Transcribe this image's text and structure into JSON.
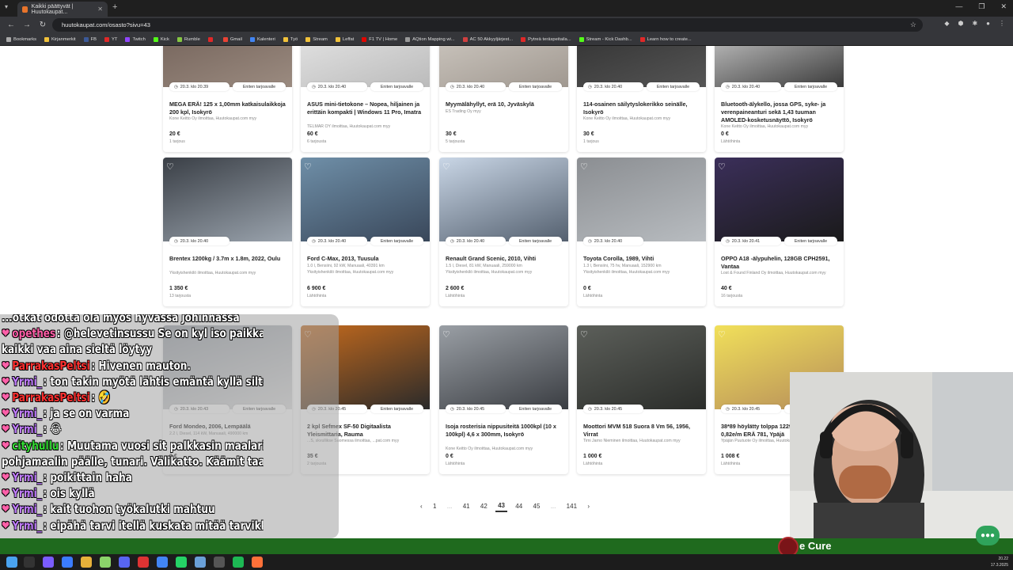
{
  "browser": {
    "tab_title": "Kaikki päättyvät | Huutokaupat...",
    "url": "huutokaupat.com/osasto?sivu=43",
    "bookmarks": [
      {
        "label": "Bookmarks",
        "color": "#aaaaaa"
      },
      {
        "label": "Kirjanmerkit",
        "color": "#f2c23a"
      },
      {
        "label": "FB",
        "color": "#3b5998"
      },
      {
        "label": "YT",
        "color": "#e02828"
      },
      {
        "label": "Twitch",
        "color": "#9146ff"
      },
      {
        "label": "Kick",
        "color": "#53fc18"
      },
      {
        "label": "Rumble",
        "color": "#85c742"
      },
      {
        "label": "",
        "color": "#e02828"
      },
      {
        "label": "Gmail",
        "color": "#ea4335"
      },
      {
        "label": "Kalenteri",
        "color": "#4285f4"
      },
      {
        "label": "Työ",
        "color": "#f2c23a"
      },
      {
        "label": "Stream",
        "color": "#f2c23a"
      },
      {
        "label": "Leffat",
        "color": "#f2c23a"
      },
      {
        "label": "F1 TV | Home",
        "color": "#e10600"
      },
      {
        "label": "AQtion Mapping wi...",
        "color": "#999999"
      },
      {
        "label": "AC 50 Akkyyljärjest...",
        "color": "#d04040"
      },
      {
        "label": "Pytreä teräspeitaila...",
        "color": "#e02828"
      },
      {
        "label": "Stream - Kick Dashb...",
        "color": "#53fc18"
      },
      {
        "label": "Learn how to create...",
        "color": "#e02828"
      }
    ]
  },
  "listings": [
    {
      "time": "20.3. klo 20.39",
      "offer": "Eniten tarjoavalle",
      "title": "MEGA ERÄ! 125 x 1,00mm katkaisulaikkoja 200 kpl, Isokyrö",
      "seller": "Kone Keitto Oy ilmoittaa, Huutokaupat.com myy",
      "price": "20 €",
      "bids": "1 tarjous"
    },
    {
      "time": "20.3. klo 20.40",
      "offer": "Eniten tarjoavalle",
      "title": "ASUS mini-tietokone – Nopea, hiljainen ja erittäin kompakti | Windows 11 Pro, Imatra",
      "seller": "TELMAR OY ilmoittaa, Huutokaupat.com myy",
      "price": "60 €",
      "bids": "6 tarjousta"
    },
    {
      "time": "20.3. klo 20.40",
      "offer": "Eniten tarjoavalle",
      "title": "Myymälähyllyt, erä 10, Jyväskylä",
      "seller": "ES Trading Oy myy",
      "price": "30 €",
      "bids": "5 tarjousta"
    },
    {
      "time": "20.3. klo 20.40",
      "offer": "Eniten tarjoavalle",
      "title": "114-osainen säilytyslokerikko seinälle, Isokyrö",
      "seller": "Kone Keitto Oy ilmoittaa, Huutokaupat.com myy",
      "price": "30 €",
      "bids": "1 tarjous"
    },
    {
      "time": "20.3. klo 20.40",
      "offer": "Eniten tarjoavalle",
      "title": "Bluetooth-älykello, jossa GPS, syke- ja verenpaineanturi sekä 1,43 tuuman AMOLED-kosketusnäyttö, Isokyrö",
      "seller": "Kone Keitto Oy ilmoittaa, Huutokaupat.com myy",
      "price": "0 €",
      "bids": "Lähtöhinta"
    },
    {
      "time": "20.3. klo 20.40",
      "offer": "",
      "title": "Brentex 1200kg / 3.7m x 1.8m, 2022, Oulu",
      "seller": "Yksityishenkilö ilmoittaa, Huutokaupat.com myy",
      "price": "1 350 €",
      "bids": "13 tarjousta"
    },
    {
      "time": "20.3. klo 20.40",
      "offer": "Eniten tarjoavalle",
      "title": "Ford C-Max, 2013, Tuusula",
      "seller": "1.0 l, Bensiini, 92 kW, Manuaali, 40391 km\nYksityishenkilö ilmoittaa, Huutokaupat.com myy",
      "price": "6 900 €",
      "bids": "Lähtöhinta"
    },
    {
      "time": "20.3. klo 20.40",
      "offer": "Eniten tarjoavalle",
      "title": "Renault Grand Scenic, 2010, Vihti",
      "seller": "1.5 l, Diesel, 81 kW, Manuaali, 259000 km\nYksityishenkilö ilmoittaa, Huutokaupat.com myy",
      "price": "2 600 €",
      "bids": "Lähtöhinta"
    },
    {
      "time": "20.3. klo 20.40",
      "offer": "",
      "title": "Toyota Corolla, 1989, Vihti",
      "seller": "1.3 l, Bensiini, 75 hv, Manuaali, 152900 km\nYksityishenkilö ilmoittaa, Huutokaupat.com myy",
      "price": "0 €",
      "bids": "Lähtöhinta"
    },
    {
      "time": "20.3. klo 20.41",
      "offer": "Eniten tarjoavalle",
      "title": "OPPO A18 -älypuhelin, 128GB CPH2591, Vantaa",
      "seller": "Lost & Found Finland Oy ilmoittaa, Huutokaupat.com myy",
      "price": "40 €",
      "bids": "16 tarjousta"
    },
    {
      "time": "20.3. klo 20.43",
      "offer": "Eniten tarjoavalle",
      "title": "Ford Mondeo, 2006, Lempäälä",
      "seller": "2.2 l, Diesel, 114 kW, Manuaali, 490000 km",
      "price": "0 €",
      "bids": "Lähtöhinta"
    },
    {
      "time": "20.3. klo 20.45",
      "offer": "Eniten tarjoavalle",
      "title": "2 kpl Sefmex SF-50 Digitaalista Yleismittaria, Rauma",
      "seller": "...S, skvullikse Suomessa ilmoittaa, ...pat.com myy",
      "price": "35 €",
      "bids": "2 tarjousta"
    },
    {
      "time": "20.3. klo 20.45",
      "offer": "Eniten tarjoavalle",
      "title": "Isoja rosterisia nippusiteitä 1000kpl (10 x 100kpl) 4,6 x 300mm, Isokyrö",
      "seller": "Kone Keitto Oy ilmoittaa, Huutokaupat.com myy",
      "price": "0 €",
      "bids": "Lähtöhinta"
    },
    {
      "time": "20.3. klo 20.45",
      "offer": "",
      "title": "Moottori MVM 518 Suora 8 Vm 56, 1956, Virrat",
      "seller": "Timi Jarno Nieminen ilmoittaa, Huutokaupat.com myy",
      "price": "1 000 €",
      "bids": "Lähtöhinta"
    },
    {
      "time": "20.3. klo 20.45",
      "offer": "Eniten tarjoavalle",
      "title": "38*89 höylätty tolppa 1229m n.1,8€/m 0,82e/m ERÄ 781, Ypäjä",
      "seller": "Ypäjän Puutuote Oy ilmoittaa, Huutokaupat.com myy",
      "price": "1 008 €",
      "bids": "Lähtöhinta"
    }
  ],
  "pagination": [
    "1",
    "...",
    "41",
    "42",
    "43",
    "44",
    "45",
    "...",
    "141"
  ],
  "pagination_current": "43",
  "chat": [
    {
      "user": "",
      "text": "...otkat odotta ola myos hyvassa johinnassa",
      "color": "#ffffff"
    },
    {
      "user": "opethes",
      "text": ": @helevetinsussu Se on kyl iso paikka se jemma ku",
      "color": "#ff5fa8"
    },
    {
      "user": "",
      "text": "kaikki vaa aina sieltä löytyy",
      "color": "#ffffff"
    },
    {
      "user": "ParrakasPeltsi",
      "text": ": Hivenen mauton.",
      "color": "#ff3030"
    },
    {
      "user": "Yrmi_",
      "text": ": ton takin myötä lähtis emäntä kyllä siltä istumalta",
      "color": "#c07cff"
    },
    {
      "user": "ParrakasPeltsi",
      "text": ": 🤣",
      "color": "#ff3030"
    },
    {
      "user": "Yrmi_",
      "text": ": ja se on varma",
      "color": "#c07cff"
    },
    {
      "user": "Yrmi_",
      "text": ": 😂",
      "color": "#c07cff"
    },
    {
      "user": "cityhullu",
      "text": ": Muutama vuosi sit palkkasin maalarin, se veti pohjamaalit",
      "color": "#33dd33"
    },
    {
      "user": "",
      "text": "pohjamaalin päälle, tunari. Välikatto. Käämit taas palo.",
      "color": "#ffffff"
    },
    {
      "user": "Yrmi_",
      "text": ": poikittain haha",
      "color": "#c07cff"
    },
    {
      "user": "Yrmi_",
      "text": ": ois kyllä",
      "color": "#c07cff"
    },
    {
      "user": "Yrmi_",
      "text": ": kait tuohon työkalutki mahtuu",
      "color": "#c07cff"
    },
    {
      "user": "Yrmi_",
      "text": ": eipähä tarvi itellä kuskata mitää tarvikkeita",
      "color": "#c07cff"
    }
  ],
  "now_playing": "e Cure",
  "clock": {
    "time": "20.22",
    "date": "17.3.2025"
  }
}
